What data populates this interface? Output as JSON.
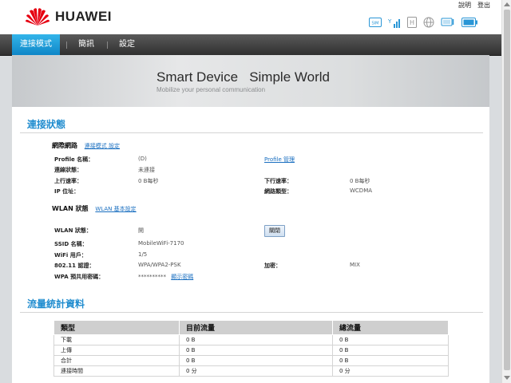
{
  "brand": {
    "name": "HUAWEI",
    "color": "#e60012"
  },
  "top_links": {
    "help": "說明",
    "logout": "登出"
  },
  "status_icons": [
    "sim-icon",
    "signal-icon",
    "network-mode-icon",
    "globe-icon",
    "wifi-device-icon",
    "battery-icon"
  ],
  "nav": {
    "tabs": [
      {
        "label": "連接模式",
        "active": true
      },
      {
        "label": "簡訊"
      },
      {
        "label": "設定"
      }
    ]
  },
  "banner": {
    "title": "Smart Device   Simple World",
    "subtitle": "Mobilize your personal communication"
  },
  "connection": {
    "title": "連接狀態",
    "network": {
      "heading": "網際網路",
      "link": "連接模式 設定",
      "profile_label": "Profile 名稱：",
      "profile_value": "(D)",
      "profile_link": "Profile 管理",
      "status_label": "連線狀態：",
      "status_value": "未連接",
      "up_label": "上行速率：",
      "up_value": "0 B每秒",
      "down_label": "下行速率：",
      "down_value": "0 B每秒",
      "ip_label": "IP 位址：",
      "ip_value": "",
      "nettype_label": "網路類型：",
      "nettype_value": "WCDMA"
    },
    "wlan": {
      "heading": "WLAN 狀態",
      "link": "WLAN 基本設定",
      "state_label": "WLAN 狀態：",
      "state_value": "開",
      "toggle_button": "關閉",
      "ssid_label": "SSID 名稱：",
      "ssid_value": "MobileWiFi-7170",
      "users_label": "WiFi 用戶：",
      "users_value": "1/5",
      "auth_label": "802.11 認證：",
      "auth_value": "WPA/WPA2-PSK",
      "enc_label": "加密：",
      "enc_value": "MIX",
      "key_label": "WPA 預共用密碼：",
      "key_value": "**********",
      "show_key": "顯示密碼"
    }
  },
  "traffic": {
    "title": "流量統計資料",
    "headers": [
      "類型",
      "目前流量",
      "總流量"
    ],
    "rows": [
      [
        "下載",
        "0 B",
        "0 B"
      ],
      [
        "上傳",
        "0 B",
        "0 B"
      ],
      [
        "合計",
        "0 B",
        "0 B"
      ],
      [
        "連接時間",
        "0 分",
        "0 分"
      ]
    ]
  }
}
